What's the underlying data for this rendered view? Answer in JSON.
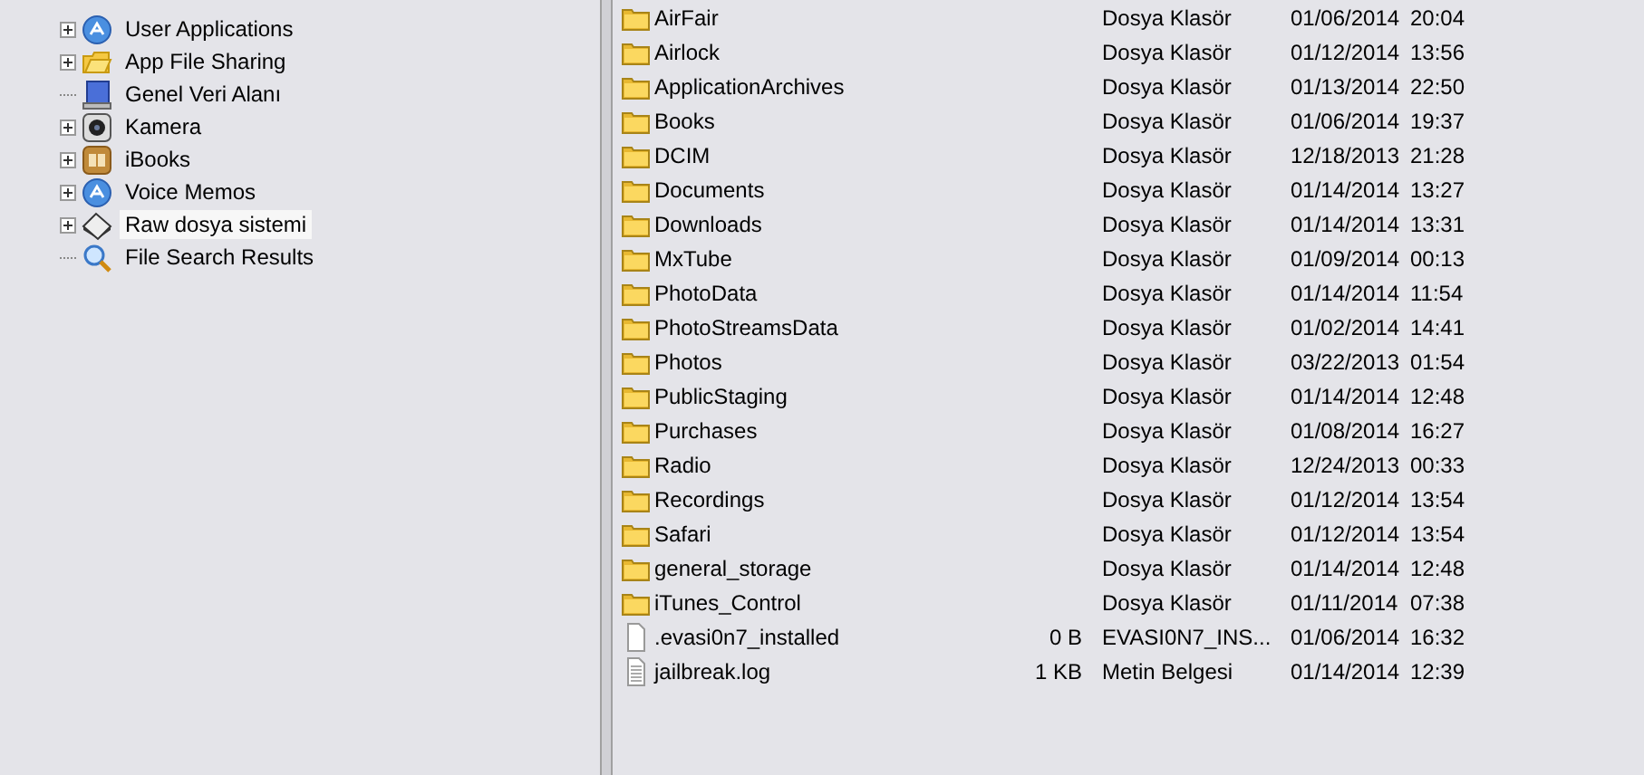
{
  "tree": {
    "items": [
      {
        "label": "User Applications",
        "kind": "app",
        "expandable": true,
        "selected": false
      },
      {
        "label": "App File Sharing",
        "kind": "folder",
        "expandable": true,
        "selected": false
      },
      {
        "label": "Genel Veri Alanı",
        "kind": "drive",
        "expandable": false,
        "selected": false
      },
      {
        "label": "Kamera",
        "kind": "camera",
        "expandable": true,
        "selected": false
      },
      {
        "label": "iBooks",
        "kind": "book",
        "expandable": true,
        "selected": false
      },
      {
        "label": "Voice Memos",
        "kind": "app",
        "expandable": true,
        "selected": false
      },
      {
        "label": "Raw dosya sistemi",
        "kind": "disk",
        "expandable": true,
        "selected": true
      },
      {
        "label": "File Search Results",
        "kind": "search",
        "expandable": false,
        "selected": false
      }
    ]
  },
  "files": {
    "rows": [
      {
        "kind": "folder",
        "name": "AirFair",
        "type": "Dosya Klasör",
        "date": "01/06/2014",
        "time": "20:04"
      },
      {
        "kind": "folder",
        "name": "Airlock",
        "type": "Dosya Klasör",
        "date": "01/12/2014",
        "time": "13:56"
      },
      {
        "kind": "folder",
        "name": "ApplicationArchives",
        "type": "Dosya Klasör",
        "date": "01/13/2014",
        "time": "22:50"
      },
      {
        "kind": "folder",
        "name": "Books",
        "type": "Dosya Klasör",
        "date": "01/06/2014",
        "time": "19:37"
      },
      {
        "kind": "folder",
        "name": "DCIM",
        "type": "Dosya Klasör",
        "date": "12/18/2013",
        "time": "21:28"
      },
      {
        "kind": "folder",
        "name": "Documents",
        "type": "Dosya Klasör",
        "date": "01/14/2014",
        "time": "13:27"
      },
      {
        "kind": "folder",
        "name": "Downloads",
        "type": "Dosya Klasör",
        "date": "01/14/2014",
        "time": "13:31"
      },
      {
        "kind": "folder",
        "name": "MxTube",
        "type": "Dosya Klasör",
        "date": "01/09/2014",
        "time": "00:13"
      },
      {
        "kind": "folder",
        "name": "PhotoData",
        "type": "Dosya Klasör",
        "date": "01/14/2014",
        "time": "11:54"
      },
      {
        "kind": "folder",
        "name": "PhotoStreamsData",
        "type": "Dosya Klasör",
        "date": "01/02/2014",
        "time": "14:41"
      },
      {
        "kind": "folder",
        "name": "Photos",
        "type": "Dosya Klasör",
        "date": "03/22/2013",
        "time": "01:54"
      },
      {
        "kind": "folder",
        "name": "PublicStaging",
        "type": "Dosya Klasör",
        "date": "01/14/2014",
        "time": "12:48"
      },
      {
        "kind": "folder",
        "name": "Purchases",
        "type": "Dosya Klasör",
        "date": "01/08/2014",
        "time": "16:27"
      },
      {
        "kind": "folder",
        "name": "Radio",
        "type": "Dosya Klasör",
        "date": "12/24/2013",
        "time": "00:33"
      },
      {
        "kind": "folder",
        "name": "Recordings",
        "type": "Dosya Klasör",
        "date": "01/12/2014",
        "time": "13:54"
      },
      {
        "kind": "folder",
        "name": "Safari",
        "type": "Dosya Klasör",
        "date": "01/12/2014",
        "time": "13:54"
      },
      {
        "kind": "folder",
        "name": "general_storage",
        "type": "Dosya Klasör",
        "date": "01/14/2014",
        "time": "12:48"
      },
      {
        "kind": "folder",
        "name": "iTunes_Control",
        "type": "Dosya Klasör",
        "date": "01/11/2014",
        "time": "07:38"
      },
      {
        "kind": "file",
        "name": ".evasi0n7_installed",
        "size": "0 B",
        "type": "EVASI0N7_INS...",
        "date": "01/06/2014",
        "time": "16:32"
      },
      {
        "kind": "text",
        "name": "jailbreak.log",
        "size": "1 KB",
        "type": "Metin Belgesi",
        "date": "01/14/2014",
        "time": "12:39"
      }
    ]
  }
}
